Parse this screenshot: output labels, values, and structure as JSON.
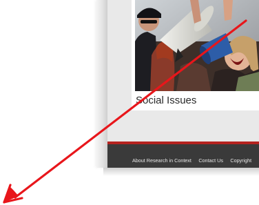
{
  "section": {
    "title": "Social Issues"
  },
  "footer": {
    "links": [
      "About Research in Context",
      "Contact Us",
      "Copyright"
    ]
  },
  "annotation": {
    "arrow_color": "#e8161b"
  },
  "colors": {
    "footer_accent": "#b5231f",
    "footer_background": "#3a3a3a"
  }
}
